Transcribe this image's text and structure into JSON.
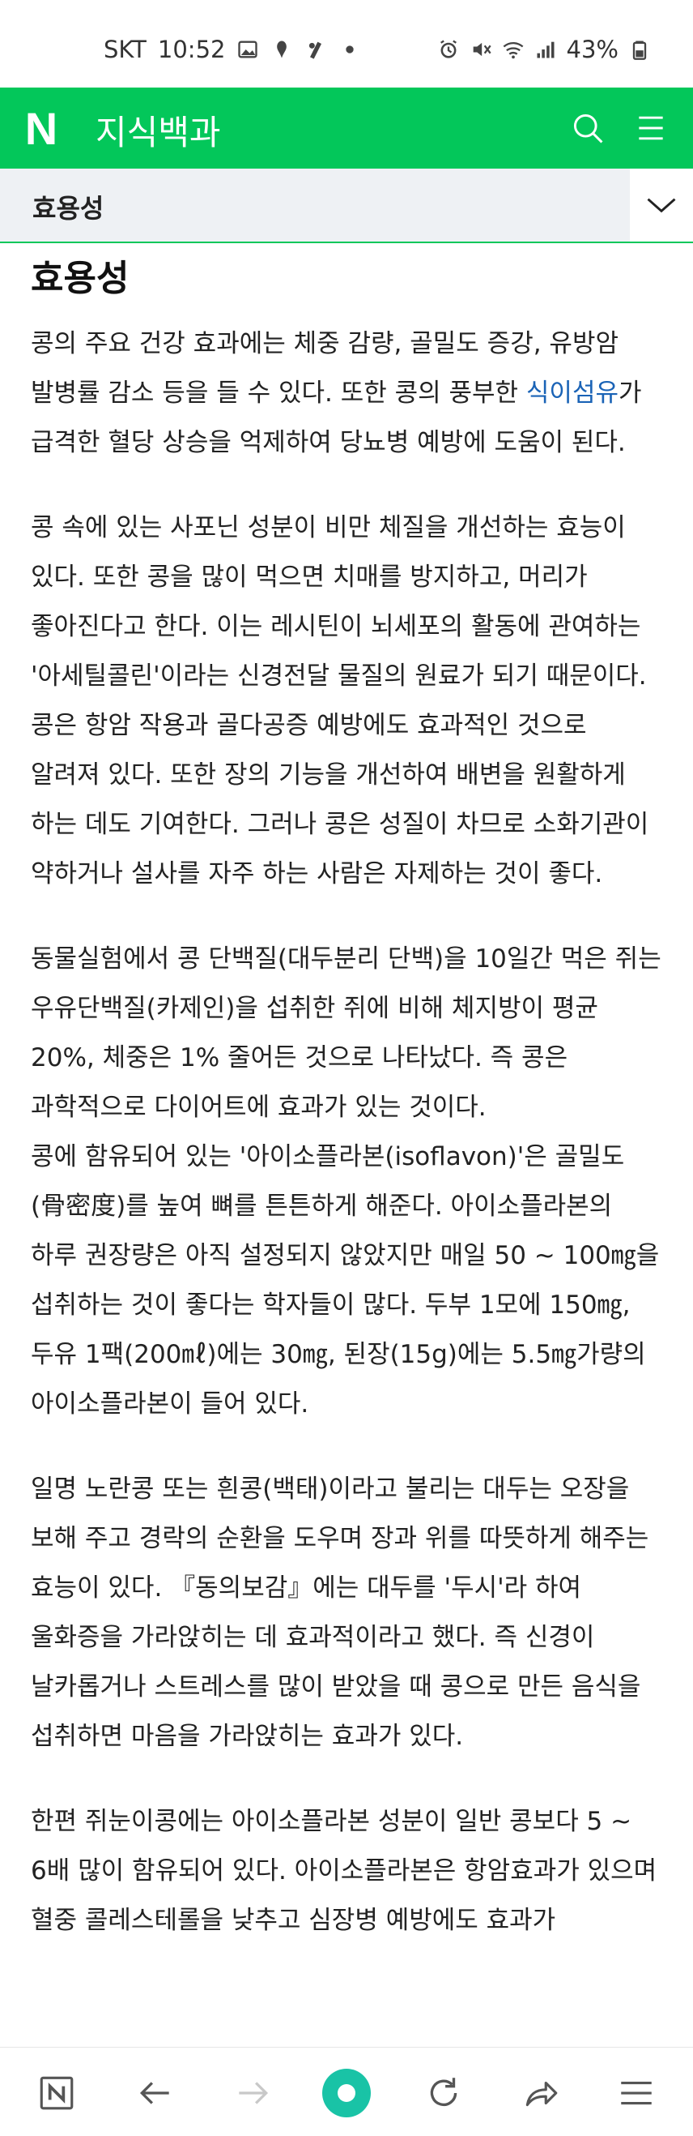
{
  "status_bar": {
    "carrier": "SKT",
    "time": "10:52",
    "battery": "43%",
    "left_icons": [
      "gallery-icon",
      "app-notification-icon",
      "app-notification-icon",
      "dot-icon"
    ],
    "right_icons": [
      "alarm-icon",
      "mute-icon",
      "wifi-icon",
      "signal-icon",
      "battery-icon"
    ]
  },
  "app_bar": {
    "logo": "N",
    "title": "지식백과",
    "accent_color": "#03c75a"
  },
  "section_bar": {
    "label": "효용성"
  },
  "article": {
    "heading": "효용성",
    "p1_before_link": "콩의 주요 건강 효과에는 체중 감량, 골밀도 증강, 유방암 발병률 감소 등을 들 수 있다. 또한 콩의 풍부한 ",
    "p1_link": "식이섬유",
    "p1_after_link": "가 급격한 혈당 상승을 억제하여 당뇨병 예방에 도움이 된다.",
    "p2": "콩 속에 있는 사포닌 성분이 비만 체질을 개선하는 효능이 있다. 또한 콩을 많이 먹으면 치매를 방지하고, 머리가 좋아진다고 한다. 이는 레시틴이 뇌세포의 활동에 관여하는 '아세틸콜린'이라는 신경전달 물질의 원료가 되기 때문이다.",
    "p3": "콩은 항암 작용과 골다공증 예방에도 효과적인 것으로 알려져 있다. 또한 장의 기능을 개선하여 배변을 원활하게 하는 데도 기여한다. 그러나 콩은 성질이 차므로 소화기관이 약하거나 설사를 자주 하는 사람은 자제하는 것이 좋다.",
    "p4": "동물실험에서 콩 단백질(대두분리 단백)을 10일간 먹은 쥐는 우유단백질(카제인)을 섭취한 쥐에 비해 체지방이 평균 20%, 체중은 1% 줄어든 것으로 나타났다. 즉 콩은 과학적으로 다이어트에 효과가 있는 것이다.",
    "p5": "콩에 함유되어 있는 '아이소플라본(isoflavon)'은 골밀도(骨密度)를 높여 뼈를 튼튼하게 해준다. 아이소플라본의 하루 권장량은 아직 설정되지 않았지만 매일 50 ~ 100㎎을 섭취하는 것이 좋다는 학자들이 많다. 두부 1모에 150㎎, 두유 1팩(200㎖)에는 30㎎, 된장(15g)에는 5.5㎎가량의 아이소플라본이 들어 있다.",
    "p6": "일명 노란콩 또는 흰콩(백태)이라고 불리는 대두는 오장을 보해 주고 경락의 순환을 도우며 장과 위를 따뜻하게 해주는 효능이 있다. 『동의보감』에는 대두를 '두시'라 하여 울화증을 가라앉히는 데 효과적이라고 했다. 즉 신경이 날카롭거나 스트레스를 많이 받았을 때 콩으로 만든 음식을 섭취하면 마음을 가라앉히는 효과가 있다.",
    "p7": "한편 쥐눈이콩에는 아이소플라본 성분이 일반 콩보다 5 ~ 6배 많이 함유되어 있다. 아이소플라본은 항암효과가 있으며 혈중 콜레스테롤을 낮추고 심장병 예방에도 효과가"
  },
  "bottom_nav": {
    "items": [
      "naver-home-icon",
      "back-arrow-icon",
      "forward-arrow-icon",
      "green-dot-icon",
      "refresh-icon",
      "share-icon",
      "menu-icon"
    ],
    "center_color": "#19c3a6"
  }
}
